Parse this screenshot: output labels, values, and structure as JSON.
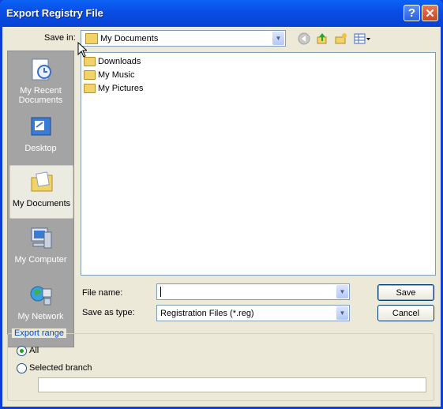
{
  "window": {
    "title": "Export Registry File"
  },
  "titlebar_buttons": {
    "help": "?",
    "close": "✕"
  },
  "save_in": {
    "label": "Save in:",
    "value": "My Documents"
  },
  "places": [
    {
      "label": "My Recent Documents",
      "icon": "recent-documents-icon",
      "selected": false
    },
    {
      "label": "Desktop",
      "icon": "desktop-icon",
      "selected": false
    },
    {
      "label": "My Documents",
      "icon": "my-documents-icon",
      "selected": true
    },
    {
      "label": "My Computer",
      "icon": "my-computer-icon",
      "selected": false
    },
    {
      "label": "My Network",
      "icon": "my-network-icon",
      "selected": false
    }
  ],
  "files": [
    {
      "name": "Downloads",
      "icon": "folder-icon"
    },
    {
      "name": "My Music",
      "icon": "music-folder-icon"
    },
    {
      "name": "My Pictures",
      "icon": "pictures-folder-icon"
    }
  ],
  "file_name": {
    "label": "File name:",
    "value": ""
  },
  "save_as_type": {
    "label": "Save as type:",
    "value": "Registration Files (*.reg)"
  },
  "buttons": {
    "save": "Save",
    "cancel": "Cancel"
  },
  "export_range": {
    "legend": "Export range",
    "all_label": "All",
    "selected_branch_label": "Selected branch",
    "selected": "All",
    "branch_value": ""
  }
}
